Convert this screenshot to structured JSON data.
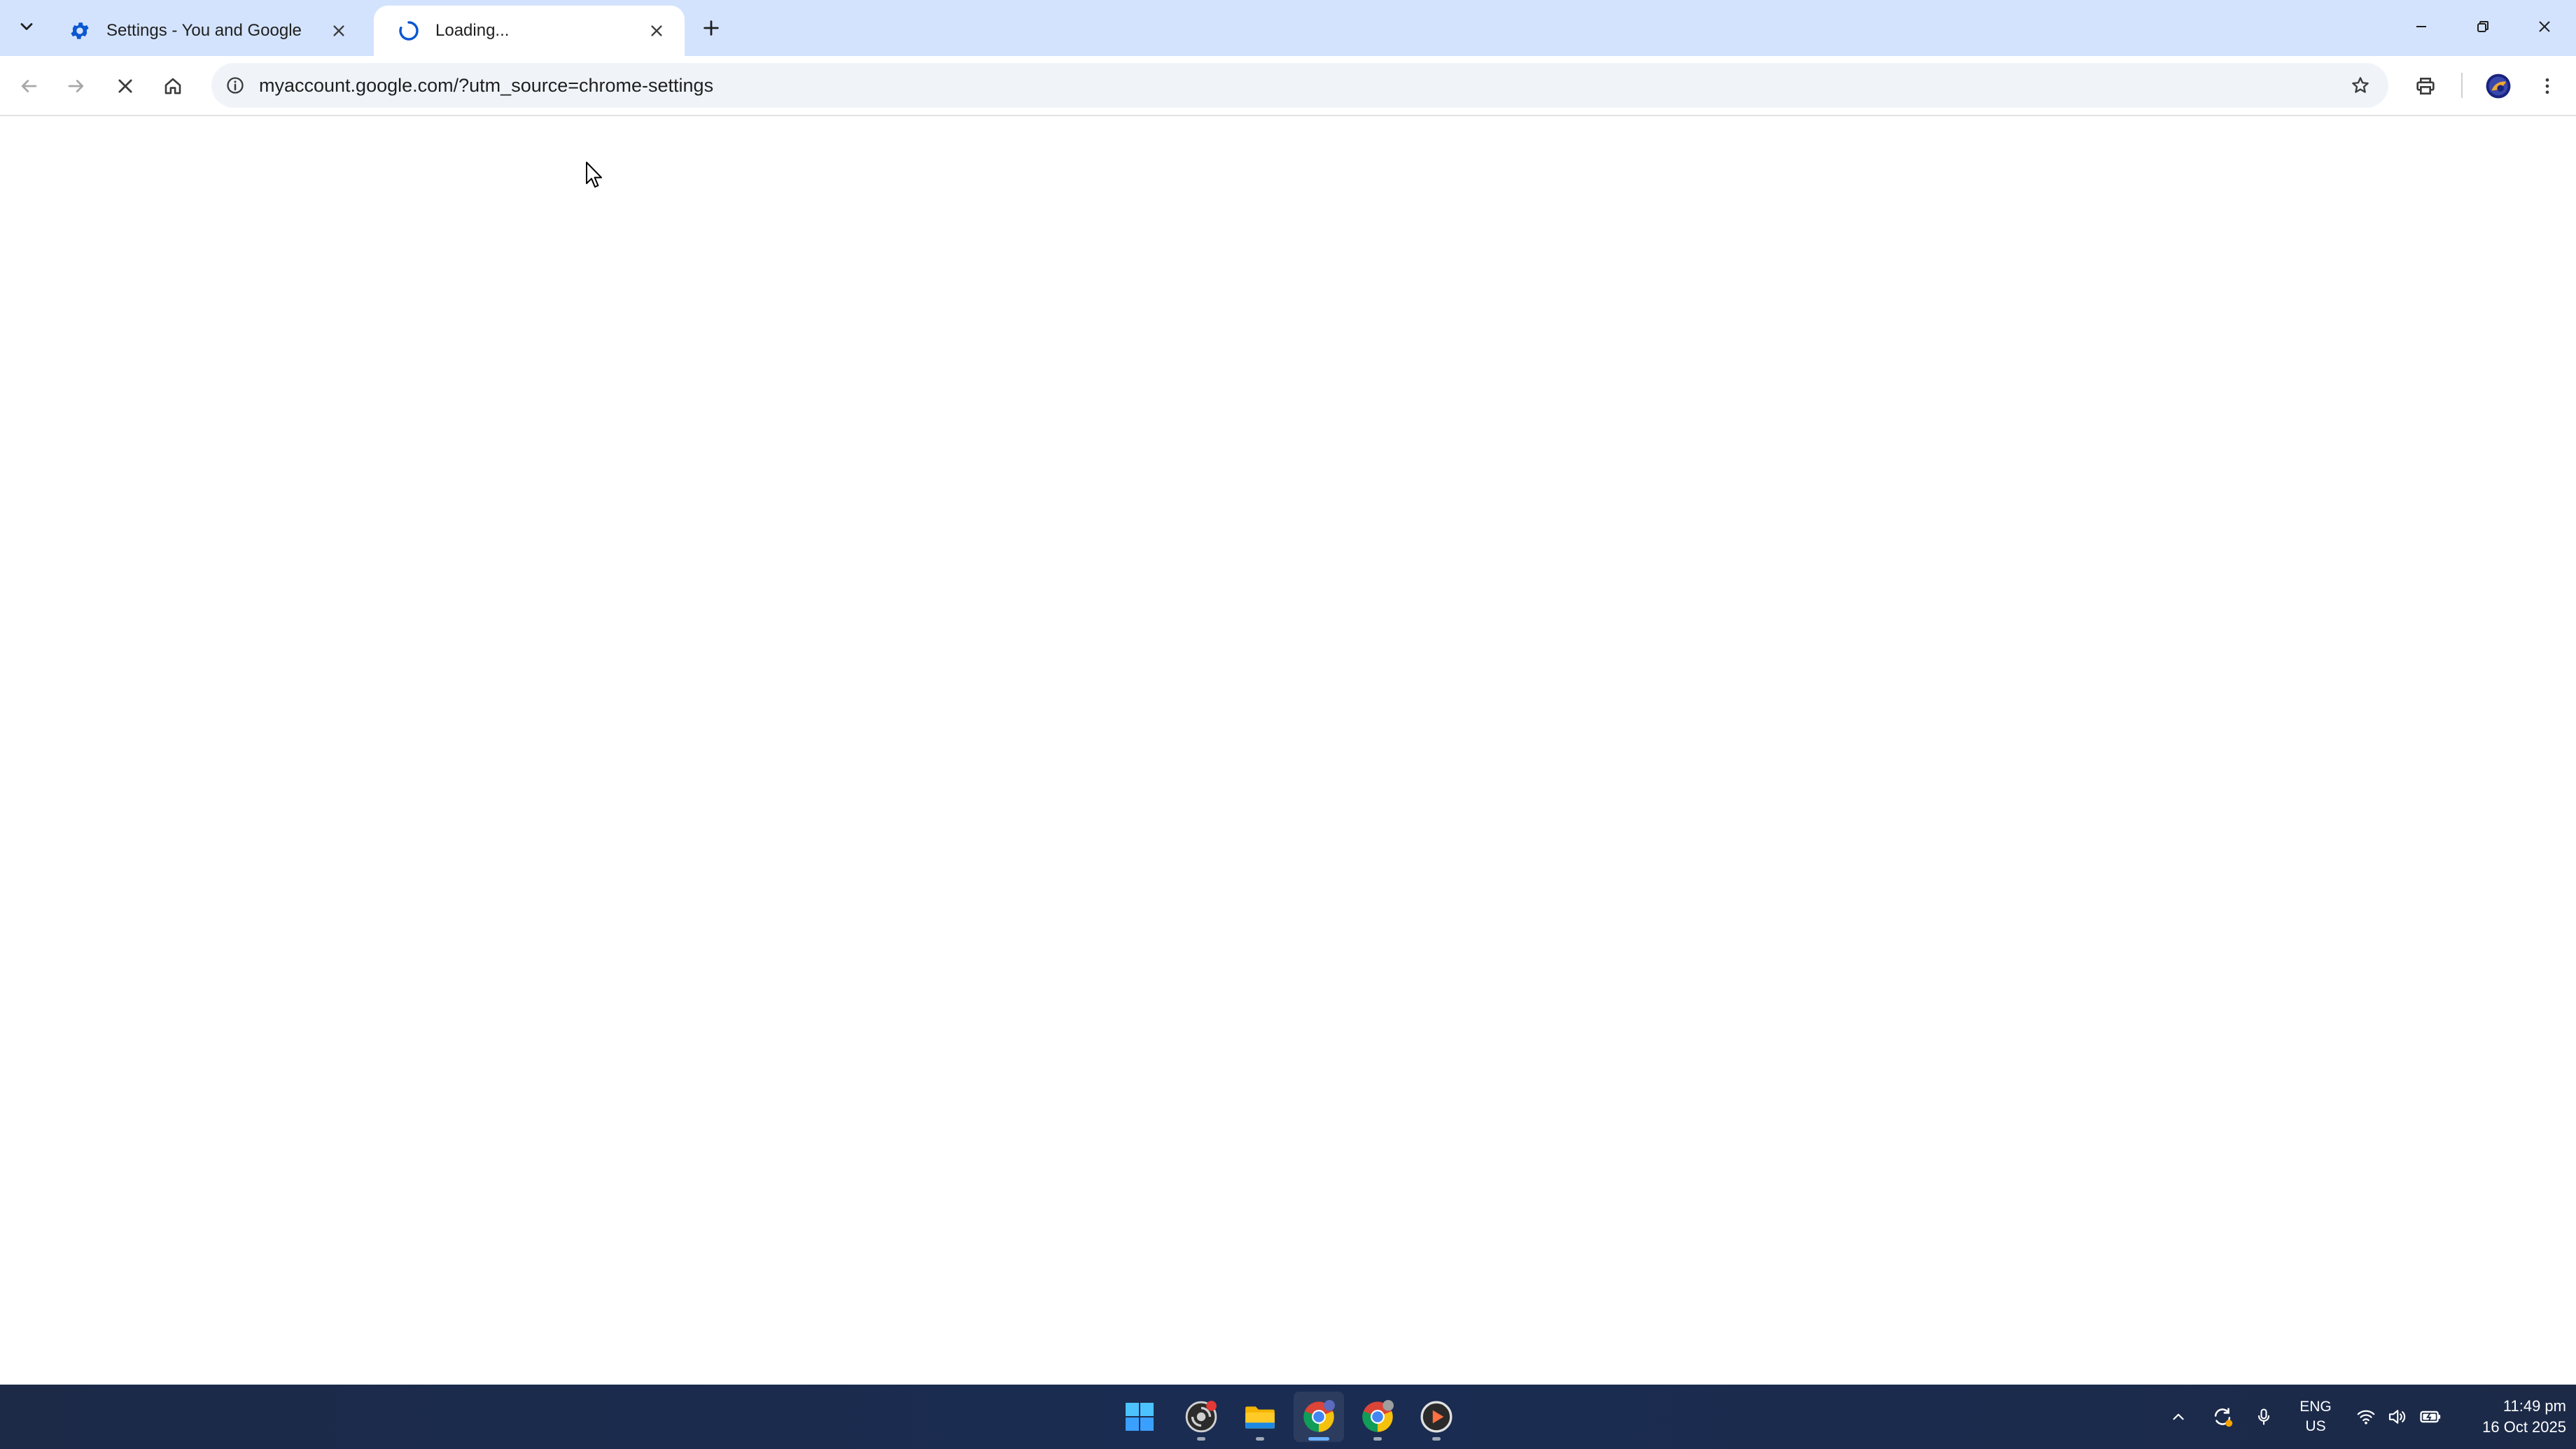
{
  "browser": {
    "tabs": [
      {
        "title": "Settings - You and Google",
        "icon": "gear-icon",
        "active": false
      },
      {
        "title": "Loading...",
        "icon": "loading-spinner-icon",
        "active": true
      }
    ],
    "address_bar": {
      "url": "myaccount.google.com/?utm_source=chrome-settings"
    }
  },
  "taskbar": {
    "apps": [
      {
        "name": "start-icon"
      },
      {
        "name": "chrome-profile-icon"
      },
      {
        "name": "file-explorer-icon"
      },
      {
        "name": "chrome-icon",
        "active": true
      },
      {
        "name": "chrome-icon"
      },
      {
        "name": "media-player-icon"
      }
    ],
    "tray": {
      "language_top": "ENG",
      "language_bottom": "US",
      "time": "11:49 pm",
      "date": "16 Oct 2025"
    }
  },
  "colors": {
    "tab_strip": "#d3e3fd",
    "omnibox": "#f0f4f9",
    "taskbar": "#1c2a48",
    "accent": "#0b57d0"
  }
}
